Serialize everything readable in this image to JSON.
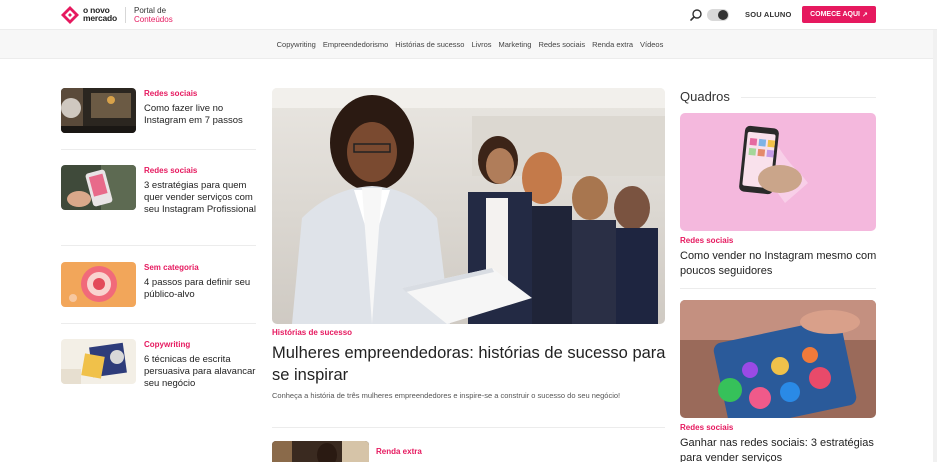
{
  "header": {
    "logo_line1": "o novo",
    "logo_line2": "mercado",
    "portal_line1": "Portal de",
    "portal_line2": "Conteúdos",
    "student_label": "SOU ALUNO",
    "cta_label": "COMECE AQUI",
    "brand_color": "#e6195f"
  },
  "nav": {
    "items": [
      "Copywriting",
      "Empreendedorismo",
      "Histórias de sucesso",
      "Livros",
      "Marketing",
      "Redes sociais",
      "Renda extra",
      "Vídeos"
    ]
  },
  "left_posts": [
    {
      "category": "Redes sociais",
      "title": "Como fazer live no Instagram em 7 passos"
    },
    {
      "category": "Redes sociais",
      "title": "3 estratégias para quem quer vender serviços com seu Instagram Profissional"
    },
    {
      "category": "Sem categoria",
      "title": "4 passos para definir seu público-alvo"
    },
    {
      "category": "Copywriting",
      "title": "6 técnicas de escrita persuasiva para alavancar seu negócio"
    }
  ],
  "featured": {
    "category": "Histórias de sucesso",
    "title": "Mulheres empreendedoras: histórias de sucesso para se inspirar",
    "description": "Conheça a história de três mulheres empreendedores e inspire-se a construir o sucesso do seu negócio!"
  },
  "next_post": {
    "category": "Renda extra"
  },
  "sidebar": {
    "heading": "Quadros",
    "posts": [
      {
        "category": "Redes sociais",
        "title": "Como vender no Instagram mesmo com poucos seguidores"
      },
      {
        "category": "Redes sociais",
        "title": "Ganhar nas redes sociais: 3 estratégias para vender serviços"
      }
    ]
  }
}
